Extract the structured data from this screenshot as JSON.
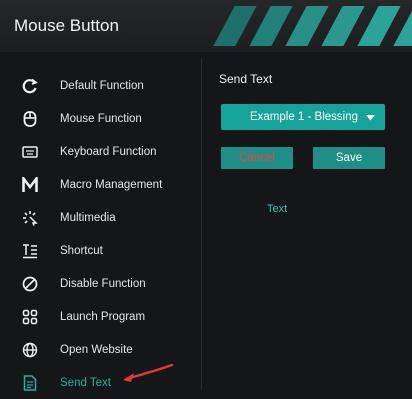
{
  "window": {
    "title": "Mouse Button"
  },
  "sidebar": {
    "items": [
      {
        "label": "Default Function",
        "icon": "refresh-icon"
      },
      {
        "label": "Mouse Function",
        "icon": "mouse-icon"
      },
      {
        "label": "Keyboard Function",
        "icon": "keyboard-icon"
      },
      {
        "label": "Macro Management",
        "icon": "macro-m-icon"
      },
      {
        "label": "Multimedia",
        "icon": "multimedia-icon"
      },
      {
        "label": "Shortcut",
        "icon": "shortcut-icon"
      },
      {
        "label": "Disable Function",
        "icon": "disable-icon"
      },
      {
        "label": "Launch Program",
        "icon": "apps-grid-icon"
      },
      {
        "label": "Open Website",
        "icon": "globe-icon"
      },
      {
        "label": "Send Text",
        "icon": "document-icon",
        "active": true
      }
    ]
  },
  "send_text": {
    "title": "Send Text",
    "dropdown_value": "Example 1 - Blessing",
    "cancel_label": "Cancel",
    "save_label": "Save",
    "text_label": "Text"
  },
  "colors": {
    "accent": "#16a39a",
    "active_text": "#1fb3a3",
    "cancel_text": "#ff3b3b",
    "annotation_arrow": "#e53935",
    "background": "#141617"
  }
}
